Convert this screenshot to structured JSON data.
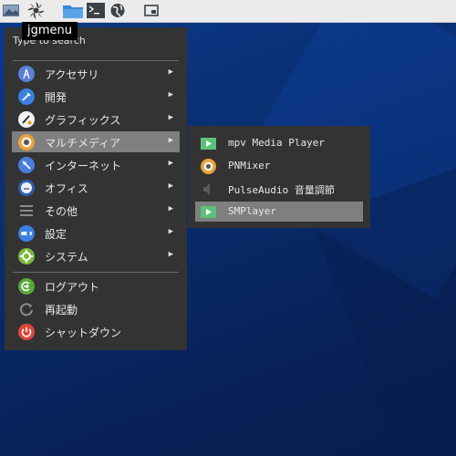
{
  "tooltip": "jgmenu",
  "panel": {
    "icons": [
      "desktop-icon",
      "jgmenu-logo-icon",
      "folder-icon",
      "terminal-icon",
      "web-browser-icon",
      "window-icon"
    ]
  },
  "main_menu": {
    "search_placeholder": "Type to search",
    "items": [
      {
        "label": "アクセサリ",
        "icon": "accessories-icon",
        "submenu": true
      },
      {
        "label": "開発",
        "icon": "development-icon",
        "submenu": true
      },
      {
        "label": "グラフィックス",
        "icon": "graphics-icon",
        "submenu": true
      },
      {
        "label": "マルチメディア",
        "icon": "multimedia-icon",
        "submenu": true,
        "active": true
      },
      {
        "label": "インターネット",
        "icon": "internet-icon",
        "submenu": true
      },
      {
        "label": "オフィス",
        "icon": "office-icon",
        "submenu": true
      },
      {
        "label": "その他",
        "icon": "other-icon",
        "submenu": true
      },
      {
        "label": "設定",
        "icon": "settings-icon",
        "submenu": true
      },
      {
        "label": "システム",
        "icon": "system-icon",
        "submenu": true
      },
      {
        "label": "ログアウト",
        "icon": "logout-icon",
        "submenu": false
      },
      {
        "label": "再起動",
        "icon": "reboot-icon",
        "submenu": false
      },
      {
        "label": "シャットダウン",
        "icon": "shutdown-icon",
        "submenu": false
      }
    ],
    "arrow": "▶"
  },
  "sub_menu": {
    "items": [
      {
        "label": "mpv Media Player",
        "icon": "mpv-icon"
      },
      {
        "label": "PNMixer",
        "icon": "pnmixer-icon"
      },
      {
        "label": "PulseAudio 音量調節",
        "icon": "pulseaudio-icon"
      },
      {
        "label": "SMPlayer",
        "icon": "smplayer-icon",
        "active": true
      }
    ]
  },
  "colors": {
    "menu_bg": "#333333",
    "highlight": "#7f7f7f",
    "panel_bg": "#ebebeb",
    "desktop": "#0a2f73"
  }
}
